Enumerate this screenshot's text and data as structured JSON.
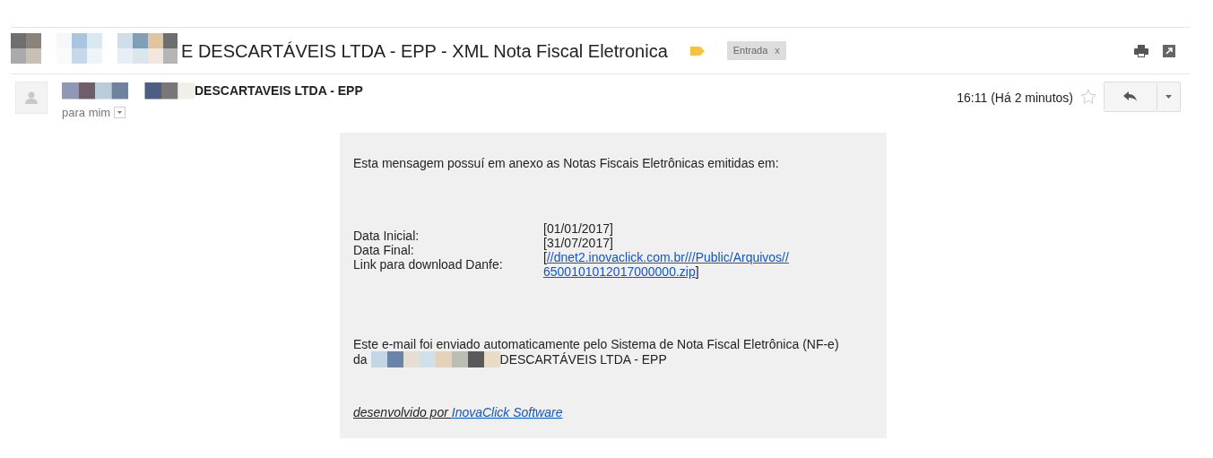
{
  "subject": {
    "text": "E DESCARTÁVEIS LTDA - EPP - XML Nota Fiscal Eletronica",
    "label_chip": {
      "text": "Entrada",
      "remove": "x"
    }
  },
  "sender": {
    "name": "DESCARTAVEIS LTDA - EPP",
    "recipient": "para mim",
    "time": "16:11 (Há 2 minutos)",
    "starred": false
  },
  "body": {
    "intro": "Esta mensagem possuí em anexo as Notas Fiscais Eletrônicas emitidas em:",
    "fields": [
      {
        "label": "Data Inicial:",
        "value": "[01/01/2017]"
      },
      {
        "label": "Data Final:",
        "value": "[31/07/2017]"
      },
      {
        "label": "Link para download Danfe:",
        "open": "[",
        "link": "//dnet2.inovaclick.com.br///Public/Arquivos//",
        "link_cont": "6500101012017000000.zip",
        "close": "]"
      }
    ],
    "footer_line1": "Este e-mail foi enviado automaticamente pelo Sistema de Nota Fiscal Eletrônica (NF-e)",
    "footer_da": "da",
    "footer_company": "DESCARTÁVEIS LTDA - EPP",
    "credit_prefix": "desenvolvido por ",
    "credit_link": "InovaClick Software"
  }
}
